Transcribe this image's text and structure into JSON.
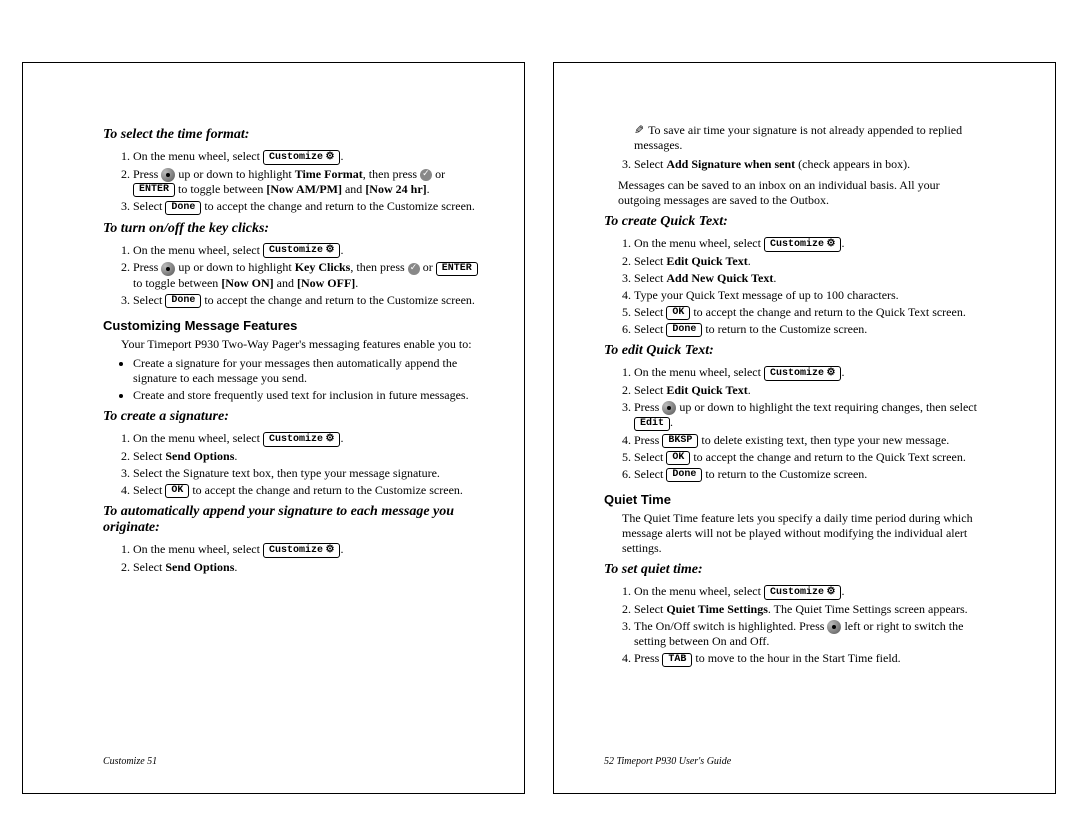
{
  "buttons": {
    "customize": "Customize",
    "done": "Done",
    "enter": "ENTER",
    "ok": "OK",
    "edit": "Edit",
    "bksp": "BKSP",
    "tab": "TAB"
  },
  "left": {
    "sec1": {
      "title": "To select the time format:",
      "li1a": "On the menu wheel, select ",
      "li2a": "Press ",
      "li2b": " up or down to highlight ",
      "li2c": "Time Format",
      "li2d": ", then press ",
      "li2e": " or ",
      "li2f": " to toggle between ",
      "li2g": "[Now AM/PM]",
      "li2h": " and ",
      "li2i": "[Now 24 hr]",
      "li3a": "Select ",
      "li3b": " to accept the change and return to the Customize screen."
    },
    "sec2": {
      "title": "To turn on/off the key clicks:",
      "li1a": "On the menu wheel, select ",
      "li2a": "Press ",
      "li2b": " up or down to highlight ",
      "li2c": "Key Clicks",
      "li2d": ", then press ",
      "li2e": " or ",
      "li2f": " to toggle between ",
      "li2g": "[Now ON]",
      "li2h": " and ",
      "li2i": "[Now OFF]",
      "li3a": "Select ",
      "li3b": " to accept the change and return to the Customize screen."
    },
    "sec3": {
      "title": "Customizing Message Features",
      "intro": "Your Timeport P930 Two-Way Pager's messaging features enable you to:",
      "b1": "Create a signature for your messages then automatically append the signature to each message you send.",
      "b2": "Create and store frequently used text for inclusion in future messages."
    },
    "sec4": {
      "title": "To create a signature:",
      "li1a": "On the menu wheel, select ",
      "li2a": "Select ",
      "li2b": "Send Options",
      "li3": "Select the Signature text box, then type your message signature.",
      "li4a": "Select ",
      "li4b": " to accept the change and return to the Customize screen."
    },
    "sec5": {
      "title": "To automatically append your signature to each message you originate:",
      "li1a": "On the menu wheel, select ",
      "li2a": "Select ",
      "li2b": "Send Options"
    },
    "footer": "Customize     51"
  },
  "right": {
    "tip": "To save air time your signature is not already appended to replied messages.",
    "li3a": "Select ",
    "li3b": "Add Signature when sent",
    "li3c": " (check appears in box).",
    "savemsg": "Messages can be saved to an inbox on an individual basis. All your outgoing messages are saved to the Outbox.",
    "sec1": {
      "title": "To create Quick Text:",
      "li1a": "On the menu wheel, select ",
      "li2a": "Select ",
      "li2b": "Edit Quick Text",
      "li3a": "Select ",
      "li3b": "Add New Quick Text",
      "li4": "Type your Quick Text message of up to 100 characters.",
      "li5a": "Select ",
      "li5b": " to accept the change and return to the Quick Text screen.",
      "li6a": "Select ",
      "li6b": " to return to the Customize screen."
    },
    "sec2": {
      "title": "To edit Quick Text:",
      "li1a": "On the menu wheel, select ",
      "li2a": "Select ",
      "li2b": "Edit Quick Text",
      "li3a": "Press ",
      "li3b": " up or down to highlight the text requiring changes, then select ",
      "li4a": "Press ",
      "li4b": " to delete existing text, then type your new message.",
      "li5a": "Select ",
      "li5b": " to accept the change and return to the Quick Text screen.",
      "li6a": "Select ",
      "li6b": " to return to the Customize screen."
    },
    "sec3": {
      "title": "Quiet Time",
      "intro": "The Quiet Time feature lets you specify a daily time period during which message alerts will not be played without modifying the individual alert settings."
    },
    "sec4": {
      "title": "To set quiet time:",
      "li1a": "On the menu wheel, select ",
      "li2a": "Select ",
      "li2b": "Quiet Time Settings",
      "li2c": ". The Quiet Time Settings screen appears.",
      "li3a": "The On/Off switch is highlighted. Press ",
      "li3b": " left or right to switch the setting between On and Off.",
      "li4a": "Press ",
      "li4b": " to move to the hour in the Start Time field."
    },
    "footer": "52     Timeport P930 User's Guide"
  }
}
